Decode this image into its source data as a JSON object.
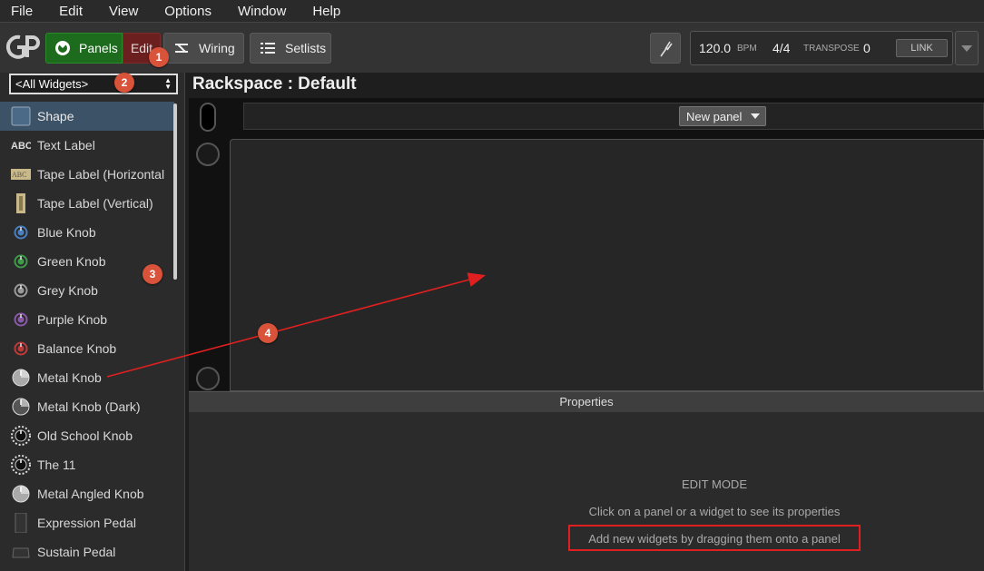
{
  "menubar": {
    "items": [
      "File",
      "Edit",
      "View",
      "Options",
      "Window",
      "Help"
    ]
  },
  "toolbar": {
    "panels_label": "Panels",
    "edit_label": "Edit",
    "wiring_label": "Wiring",
    "setlists_label": "Setlists",
    "bpm_value": "120.0",
    "bpm_label": "BPM",
    "time_signature": "4/4",
    "transpose_label": "TRANSPOSE",
    "transpose_value": "0",
    "link_label": "LINK"
  },
  "sidebar": {
    "filter_value": "<All Widgets>",
    "widgets": [
      {
        "label": "Shape",
        "icon": "shape-icon",
        "selected": true
      },
      {
        "label": "Text Label",
        "icon": "abc-icon"
      },
      {
        "label": "Tape Label (Horizontal",
        "icon": "tape-horizontal-icon"
      },
      {
        "label": "Tape Label (Vertical)",
        "icon": "tape-vertical-icon"
      },
      {
        "label": "Blue Knob",
        "icon": "blue-knob-icon",
        "color": "#4a7fc0"
      },
      {
        "label": "Green Knob",
        "icon": "green-knob-icon",
        "color": "#3f9a4a"
      },
      {
        "label": "Grey Knob",
        "icon": "grey-knob-icon",
        "color": "#9a9a9a"
      },
      {
        "label": "Purple Knob",
        "icon": "purple-knob-icon",
        "color": "#8a5aa8"
      },
      {
        "label": "Balance Knob",
        "icon": "balance-knob-icon",
        "color": "#c03a3a"
      },
      {
        "label": "Metal Knob",
        "icon": "metal-knob-icon"
      },
      {
        "label": "Metal Knob (Dark)",
        "icon": "metal-knob-dark-icon"
      },
      {
        "label": "Old School Knob",
        "icon": "old-school-knob-icon"
      },
      {
        "label": "The 11",
        "icon": "the-11-knob-icon"
      },
      {
        "label": "Metal Angled Knob",
        "icon": "metal-angled-knob-icon"
      },
      {
        "label": "Expression Pedal",
        "icon": "expression-pedal-icon"
      },
      {
        "label": "Sustain Pedal",
        "icon": "sustain-pedal-icon"
      }
    ]
  },
  "main": {
    "rackspace_title": "Rackspace : Default",
    "new_panel_label": "New panel"
  },
  "properties": {
    "header": "Properties",
    "mode": "EDIT MODE",
    "hint1": "Click on a panel or a widget to see its properties",
    "hint2": "Add new widgets by dragging them onto a panel"
  },
  "annotations": {
    "b1": "1",
    "b2": "2",
    "b3": "3",
    "b4": "4"
  },
  "colors": {
    "accent_red": "#e02020",
    "badge": "#d9533a",
    "panels_green": "#1d6b1d",
    "edit_red": "#6b1f1f",
    "selected_row": "#3c5266"
  }
}
